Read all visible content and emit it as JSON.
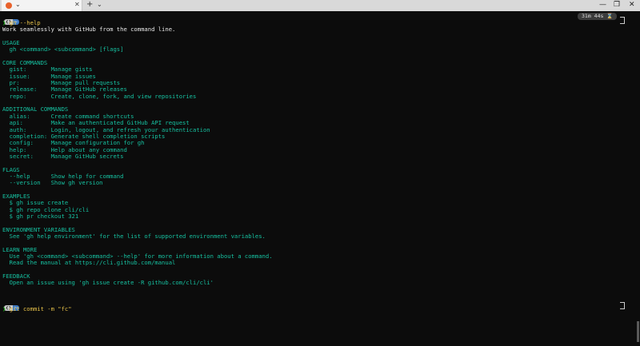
{
  "titlebar": {
    "tab_dropdown": "⌄",
    "tab_close": "✕",
    "new_tab": "+",
    "tab_menu": "⌄",
    "minimize": "—",
    "maximize": "❐",
    "close": "✕"
  },
  "prompt": {
    "os_segment": "❮❯",
    "path_segment": "~",
    "symbol": "❯",
    "timer": "31m 44s"
  },
  "command": "gh --help",
  "output": {
    "intro": "Work seamlessly with GitHub from the command line.",
    "usage_header": "USAGE",
    "usage_line": "  gh <command> <subcommand> [flags]",
    "core_header": "CORE COMMANDS",
    "core": [
      "  gist:       Manage gists",
      "  issue:      Manage issues",
      "  pr:         Manage pull requests",
      "  release:    Manage GitHub releases",
      "  repo:       Create, clone, fork, and view repositories"
    ],
    "additional_header": "ADDITIONAL COMMANDS",
    "additional": [
      "  alias:      Create command shortcuts",
      "  api:        Make an authenticated GitHub API request",
      "  auth:       Login, logout, and refresh your authentication",
      "  completion: Generate shell completion scripts",
      "  config:     Manage configuration for gh",
      "  help:       Help about any command",
      "  secret:     Manage GitHub secrets"
    ],
    "flags_header": "FLAGS",
    "flags": [
      "  --help      Show help for command",
      "  --version   Show gh version"
    ],
    "examples_header": "EXAMPLES",
    "examples": [
      "  $ gh issue create",
      "  $ gh repo clone cli/cli",
      "  $ gh pr checkout 321"
    ],
    "env_header": "ENVIRONMENT VARIABLES",
    "env_line": "  See 'gh help environment' for the list of supported environment variables.",
    "learn_header": "LEARN MORE",
    "learn": [
      "  Use 'gh <command> <subcommand> --help' for more information about a command.",
      "  Read the manual at https://cli.github.com/manual"
    ],
    "feedback_header": "FEEDBACK",
    "feedback_line": "  Open an issue using 'gh issue create -R github.com/cli/cli'"
  },
  "current_input": "git commit -m \"fc\""
}
